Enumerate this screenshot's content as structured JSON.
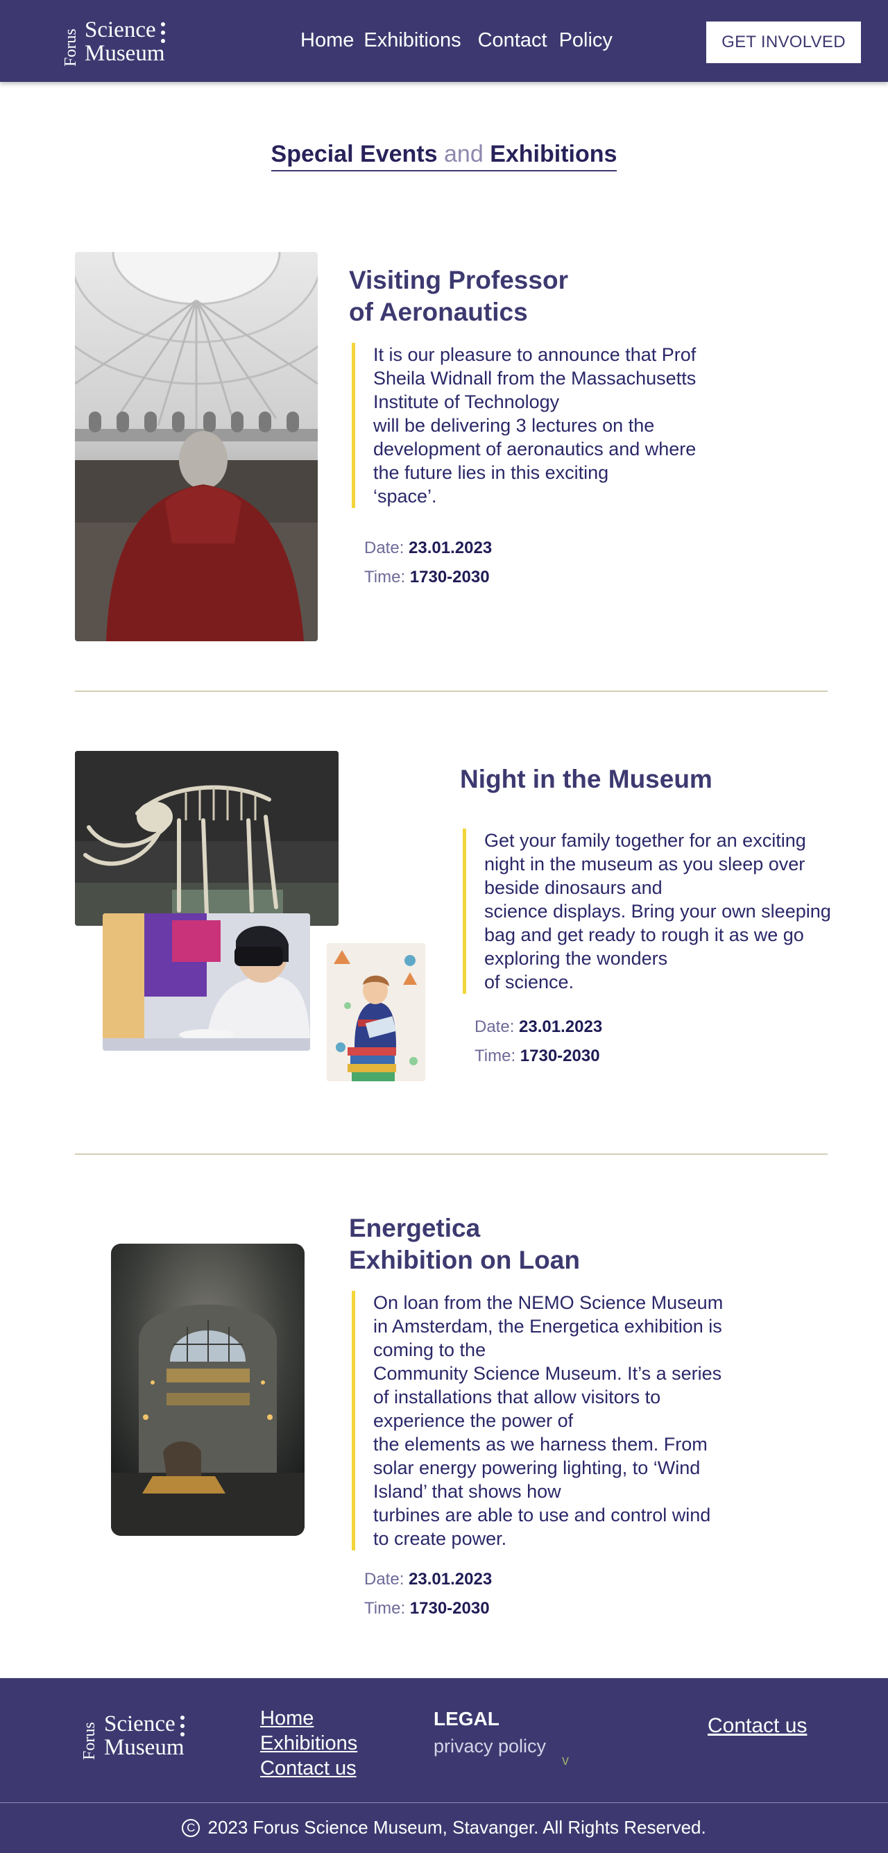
{
  "header": {
    "logo": {
      "vertical": "Forus",
      "line1": "Science",
      "line2": "Museum"
    },
    "nav": [
      "Home",
      "Exhibitions",
      "Contact",
      "Policy"
    ],
    "cta": "GET INVOLVED"
  },
  "title": {
    "part1": "Special Events",
    "part2": "and",
    "part3": "Exhibitions"
  },
  "events": [
    {
      "title": [
        "Visiting Professor",
        "of Aeronautics"
      ],
      "body": [
        "It is our pleasure to announce that Prof",
        "Sheila Widnall from the Massachusetts",
        "Institute of Technology",
        "will be delivering 3 lectures on the",
        "development of aeronautics and where",
        "the future lies in this exciting",
        "‘space’."
      ],
      "date_label": "Date:",
      "date": "23.01.2023",
      "time_label": "Time:",
      "time": "1730-2030"
    },
    {
      "title": [
        "Night in the Museum"
      ],
      "body": [
        "Get your family together for an exciting",
        "night in the museum as you sleep over",
        "beside dinosaurs and",
        "science displays. Bring your own sleeping",
        "bag and get ready to rough it as we go",
        "exploring the wonders",
        "of science."
      ],
      "date_label": "Date:",
      "date": "23.01.2023",
      "time_label": "Time:",
      "time": "1730-2030"
    },
    {
      "title": [
        "Energetica",
        "Exhibition on Loan"
      ],
      "body": [
        "On loan from the NEMO Science Museum",
        "in Amsterdam, the Energetica exhibition is",
        "coming to the",
        "Community Science Museum. It’s a series",
        "of installations that allow visitors to",
        "experience the power of",
        "the elements as we harness them. From",
        "solar energy powering lighting, to ‘Wind",
        "Island’ that shows how",
        "turbines are able to use and control wind",
        "to create power."
      ],
      "date_label": "Date:",
      "date": "23.01.2023",
      "time_label": "Time:",
      "time": "1730-2030"
    }
  ],
  "footer": {
    "links": [
      "Home",
      "Exhibitions",
      "Contact us"
    ],
    "legal_heading": "LEGAL",
    "privacy": "privacy policy",
    "chevron": "v",
    "contact": "Contact us",
    "copyright_symbol": "C",
    "copyright": "2023 Forus Science Museum, Stavanger. All Rights Reserved."
  },
  "colors": {
    "primary": "#3d3970",
    "accent": "#f2d53a",
    "divider": "#d3ceb5"
  }
}
